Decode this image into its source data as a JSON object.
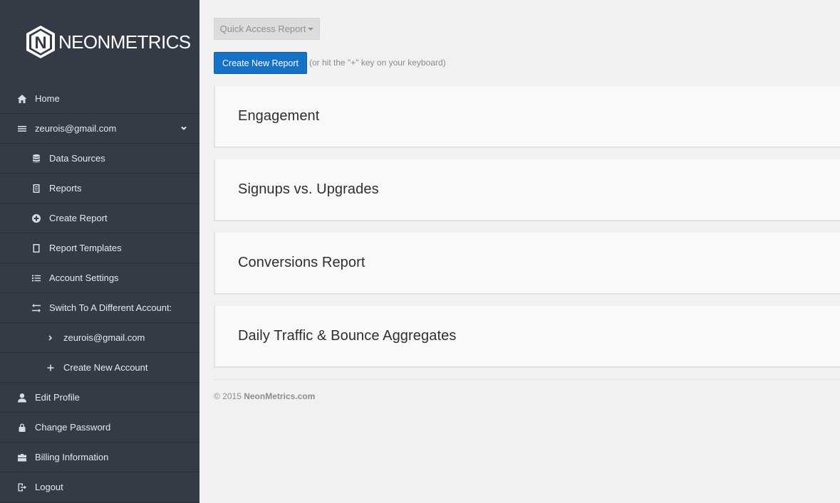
{
  "brand": {
    "name": "NEONMETRICS",
    "logo_letter": "N"
  },
  "sidebar": {
    "items": [
      {
        "label": "Home",
        "icon": "home-icon"
      },
      {
        "label": "zeurois@gmail.com",
        "icon": "menu-icon"
      },
      {
        "label": "Data Sources",
        "icon": "database-icon"
      },
      {
        "label": "Reports",
        "icon": "document-icon"
      },
      {
        "label": "Create Report",
        "icon": "plus-circle-icon"
      },
      {
        "label": "Report Templates",
        "icon": "template-icon"
      },
      {
        "label": "Account Settings",
        "icon": "list-icon"
      },
      {
        "label": "Switch To A Different Account:",
        "icon": "switch-icon"
      },
      {
        "label": "zeurois@gmail.com",
        "icon": "chevron-right-icon"
      },
      {
        "label": "Create New Account",
        "icon": "plus-icon"
      },
      {
        "label": "Edit Profile",
        "icon": "user-icon"
      },
      {
        "label": "Change Password",
        "icon": "lock-icon"
      },
      {
        "label": "Billing Information",
        "icon": "briefcase-icon"
      },
      {
        "label": "Logout",
        "icon": "logout-icon"
      }
    ]
  },
  "toolbar": {
    "quick_access_label": "Quick Access Report",
    "create_label": "Create New Report",
    "hint": "(or hit the \"+\" key on your keyboard)"
  },
  "reports": [
    {
      "title": "Engagement"
    },
    {
      "title": "Signups vs. Upgrades"
    },
    {
      "title": "Conversions Report"
    },
    {
      "title": "Daily Traffic & Bounce Aggregates"
    }
  ],
  "footer": {
    "copyright": "© 2015",
    "site": "NeonMetrics.com"
  },
  "colors": {
    "sidebar": "#343b46",
    "primary": "#1572c6",
    "background": "#f1f1f1"
  }
}
